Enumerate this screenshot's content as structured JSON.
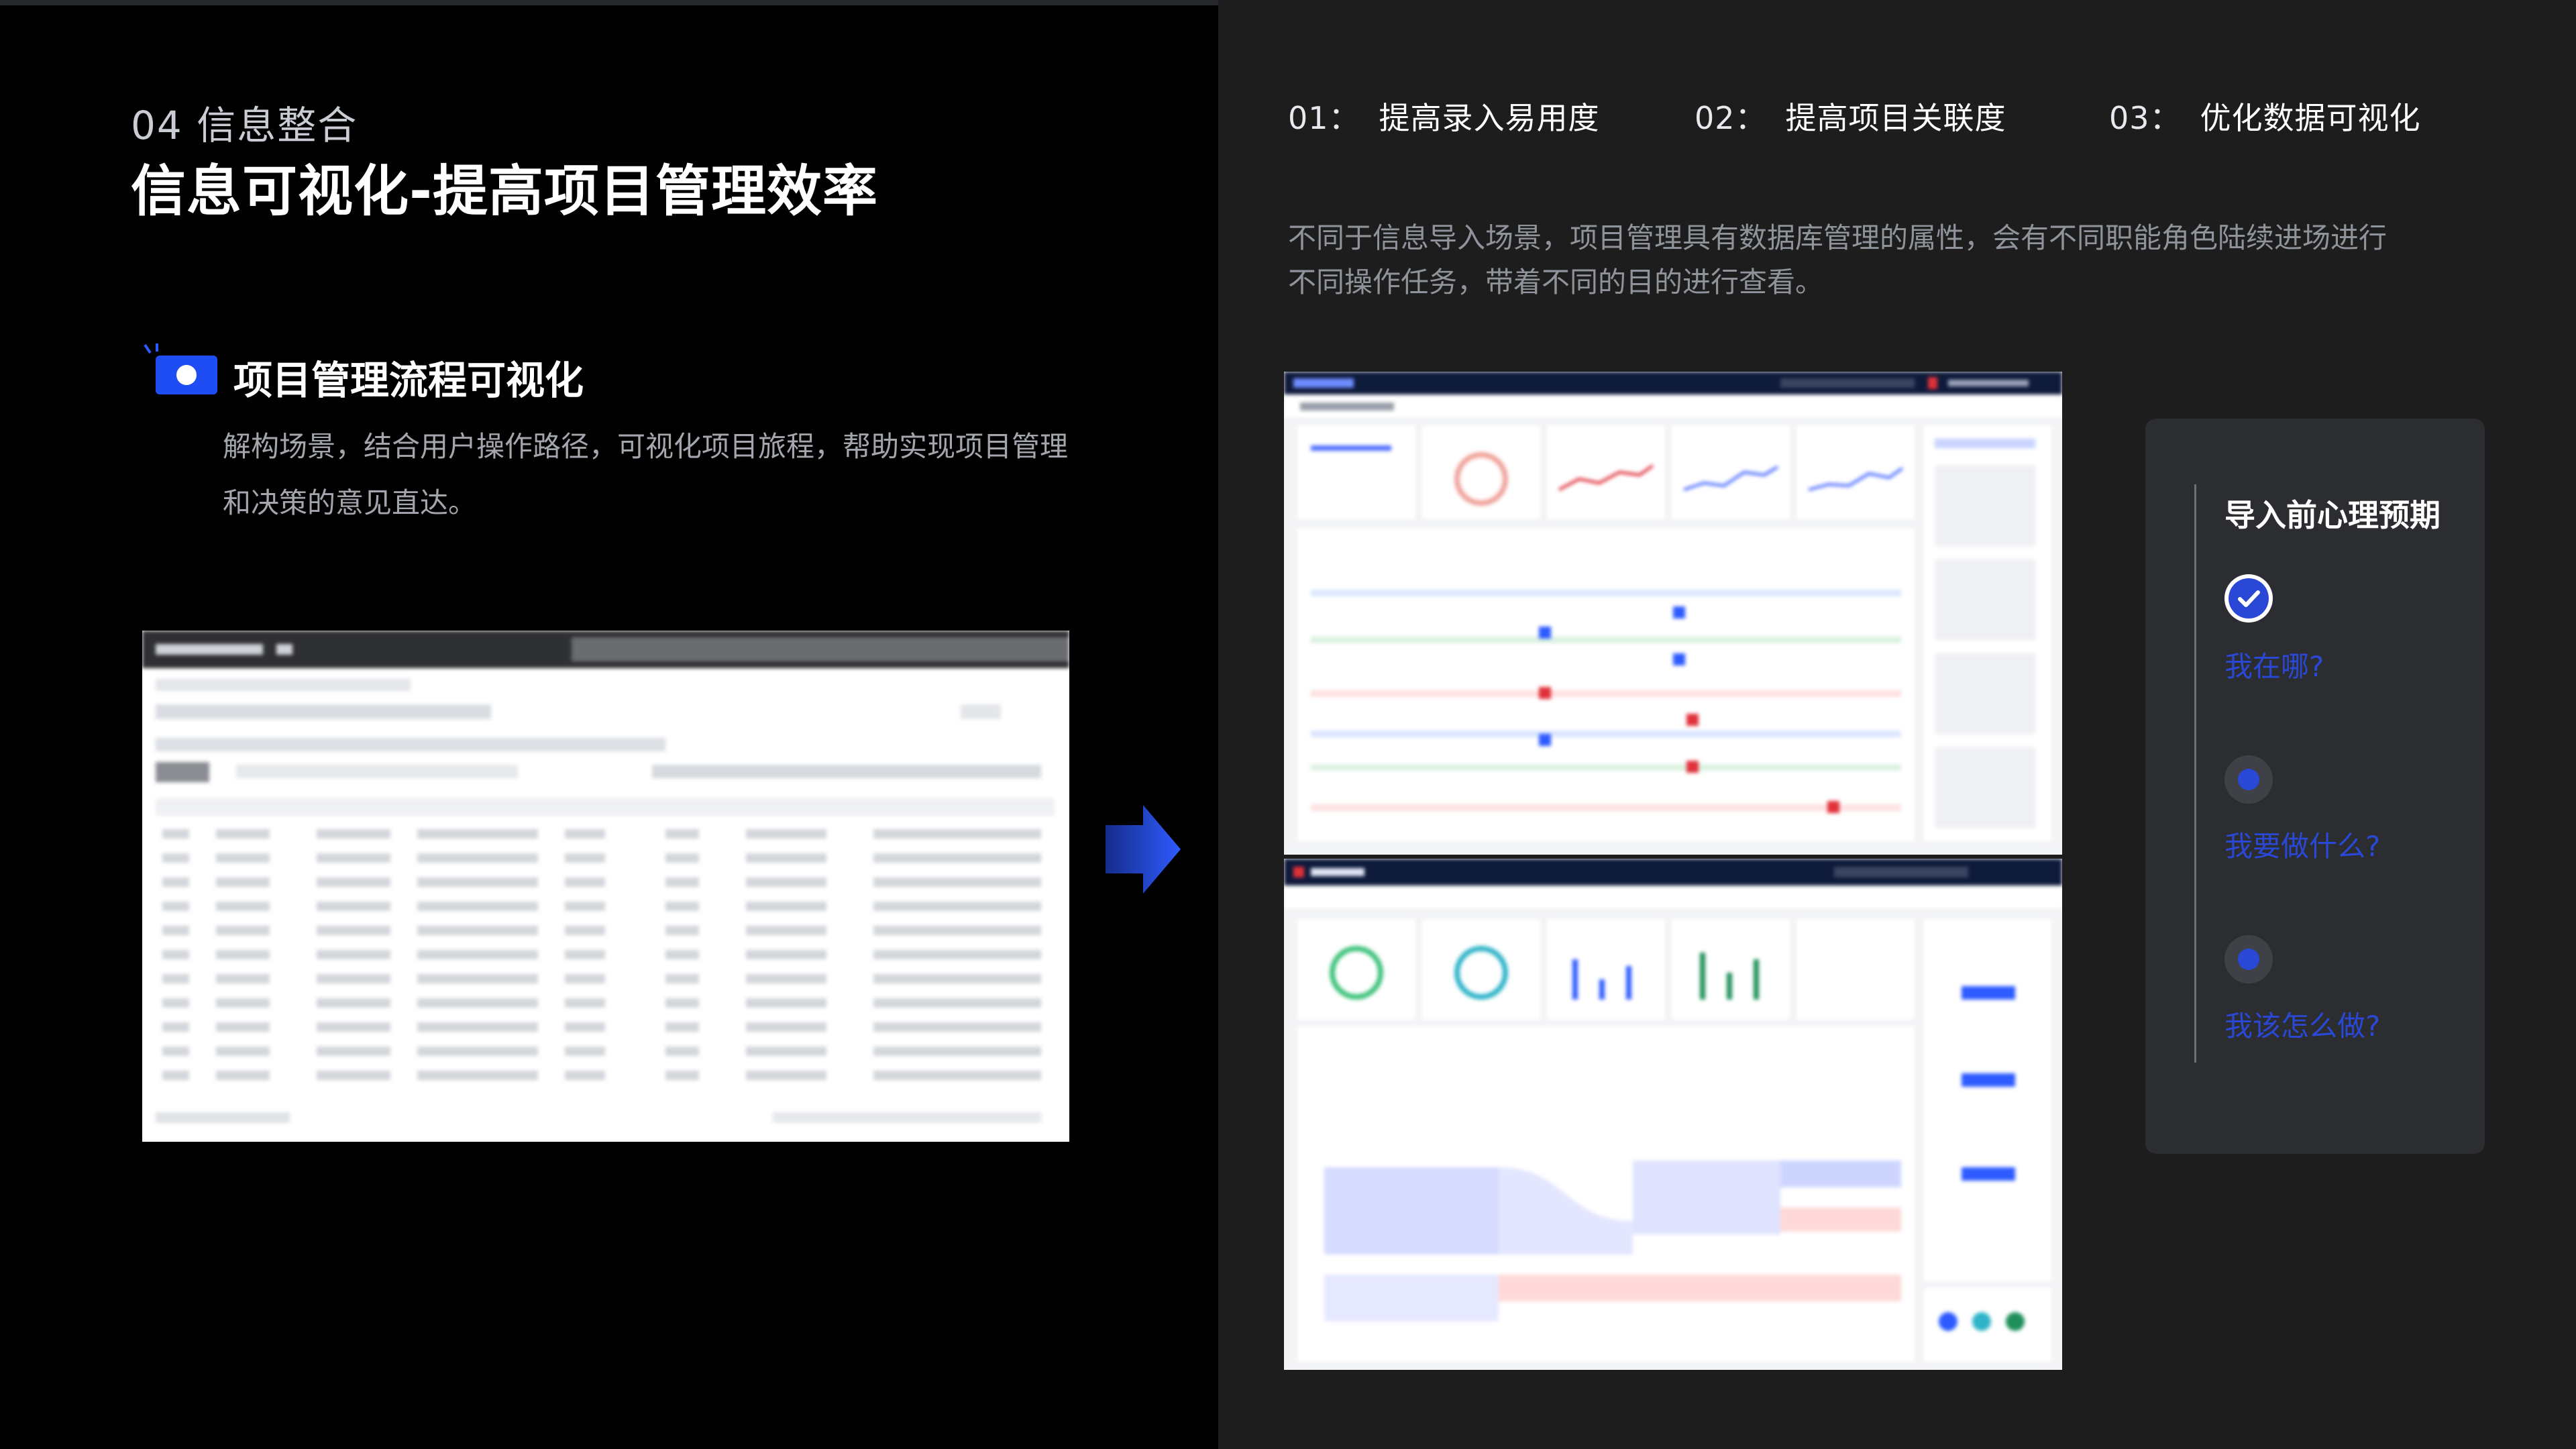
{
  "header": {
    "section": "04 信息整合",
    "title": "信息可视化-提高项目管理效率"
  },
  "feature": {
    "title": "项目管理流程可视化",
    "desc": "解构场景，结合用户操作路径，可视化项目旅程，帮助实现项目管理和决策的意见直达。"
  },
  "tabs": [
    {
      "num": "01：",
      "label": "提高录入易用度"
    },
    {
      "num": "02：",
      "label": "提高项目关联度"
    },
    {
      "num": "03：",
      "label": "优化数据可视化"
    }
  ],
  "intro": "不同于信息导入场景，项目管理具有数据库管理的属性，会有不同职能角色陆续进场进行不同操作任务，带着不同的目的进行查看。",
  "panel": {
    "title": "导入前心理预期",
    "steps": [
      {
        "label": "我在哪?",
        "state": "checked"
      },
      {
        "label": "我要做什么?",
        "state": "dot"
      },
      {
        "label": "我该怎么做?",
        "state": "dot"
      }
    ]
  },
  "colors": {
    "accent": "#2948d6",
    "left_bg": "#000000",
    "right_bg": "#1d1d1e",
    "card_bg": "#2c2d30"
  },
  "icons": {
    "feature": "camera-icon",
    "arrow": "arrow-right-icon",
    "check": "check-icon"
  }
}
